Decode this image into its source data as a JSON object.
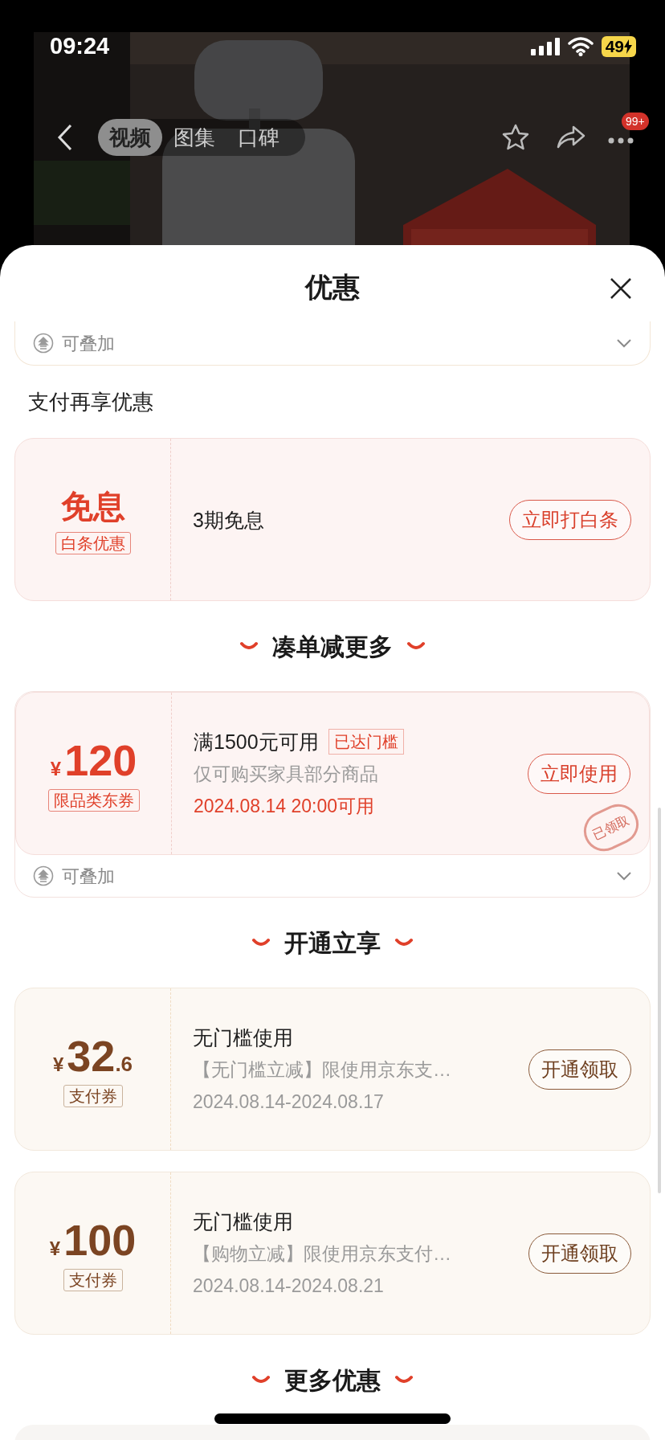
{
  "status_bar": {
    "time": "09:24",
    "battery": "49",
    "charging": true
  },
  "video_nav": {
    "tabs": [
      {
        "label": "视频",
        "selected": true
      },
      {
        "label": "图集",
        "selected": false
      },
      {
        "label": "口碑",
        "selected": false
      }
    ],
    "more_badge": "99+"
  },
  "sheet": {
    "title": "优惠",
    "blocks": [
      {
        "kind": "stack_footer",
        "label": "可叠加"
      },
      {
        "kind": "subtitle",
        "text": "支付再享优惠"
      },
      {
        "kind": "coupon",
        "color": "#e0402a",
        "main": "免息",
        "tag": "白条优惠",
        "title": "3期免息",
        "button": "立即打白条"
      },
      {
        "kind": "heading",
        "text": "凑单减更多"
      },
      {
        "kind": "coupon",
        "color": "#e0402a",
        "currency": "¥",
        "amount": "120",
        "tag": "限品类东券",
        "title": "满1500元可用",
        "badge": "已达门槛",
        "note": "仅可购买家具部分商品",
        "validity": {
          "text": "2024.08.14 20:00可用",
          "color": "#e0402a"
        },
        "button": "立即使用",
        "stamp": "已领取",
        "footer": "可叠加"
      },
      {
        "kind": "heading",
        "text": "开通立享"
      },
      {
        "kind": "coupon",
        "color": "#7b4422",
        "currency": "¥",
        "amount": "32",
        "decimals": ".6",
        "tag": "支付券",
        "title": "无门槛使用",
        "note": "【无门槛立减】限使用京东支…",
        "validity": {
          "text": "2024.08.14-2024.08.17",
          "color": "#9a9a9a"
        },
        "button": "开通领取"
      },
      {
        "kind": "coupon",
        "color": "#7b4422",
        "currency": "¥",
        "amount": "100",
        "tag": "支付券",
        "title": "无门槛使用",
        "note": "【购物立减】限使用京东支付…",
        "validity": {
          "text": "2024.08.14-2024.08.21",
          "color": "#9a9a9a"
        },
        "button": "开通领取"
      },
      {
        "kind": "heading",
        "text": "更多优惠"
      }
    ]
  }
}
